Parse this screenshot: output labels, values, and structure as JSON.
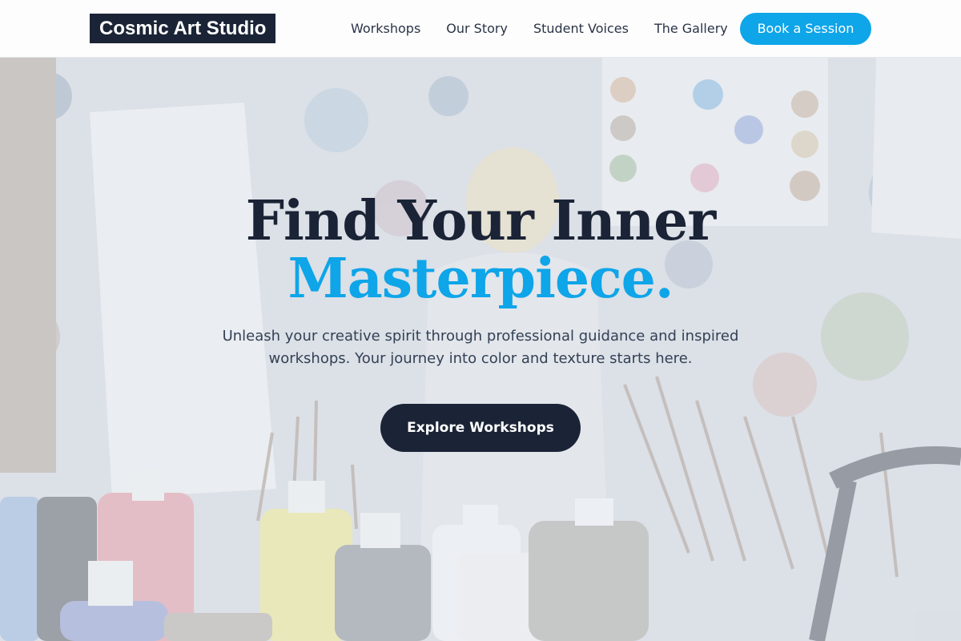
{
  "header": {
    "logo": "Cosmic Art Studio",
    "nav": [
      {
        "label": "Workshops"
      },
      {
        "label": "Our Story"
      },
      {
        "label": "Student Voices"
      },
      {
        "label": "The Gallery"
      }
    ],
    "cta_label": "Book a Session"
  },
  "hero": {
    "title_line1": "Find Your Inner",
    "title_line2": "Masterpiece.",
    "subtitle": "Unleash your creative spirit through professional guidance and inspired workshops. Your journey into color and texture starts here.",
    "button_label": "Explore Workshops"
  },
  "colors": {
    "navy": "#1b2436",
    "accent": "#0ea5e9",
    "body_text": "#334155"
  },
  "icons": {
    "background": "art-studio-photo"
  }
}
